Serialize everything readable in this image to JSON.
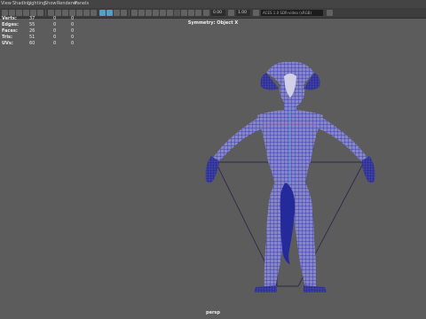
{
  "menu": [
    "View",
    "Shading",
    "Lighting",
    "Show",
    "Renderer",
    "Panels"
  ],
  "toolbar": {
    "field_1": "0.00",
    "field_2": "1.00",
    "color_space": "ACES 1.0 SDR-video (sRGB)"
  },
  "heads_up": {
    "rows": [
      {
        "label": "Verts:",
        "values": [
          "37",
          "0",
          "0"
        ]
      },
      {
        "label": "Edges:",
        "values": [
          "55",
          "0",
          "0"
        ]
      },
      {
        "label": "Faces:",
        "values": [
          "26",
          "0",
          "0"
        ]
      },
      {
        "label": "Tris:",
        "values": [
          "51",
          "0",
          "0"
        ]
      },
      {
        "label": "UVs:",
        "values": [
          "60",
          "0",
          "0"
        ]
      }
    ]
  },
  "viewport": {
    "symmetry_label": "Symmetry: Object X",
    "camera_label": "persp"
  },
  "colors": {
    "viewport_bg": "#5c5c5c",
    "mesh_wire": "#1c2aa8",
    "mesh_fill": "#8a86c4",
    "selection_highlight": "#4fa0cf"
  }
}
